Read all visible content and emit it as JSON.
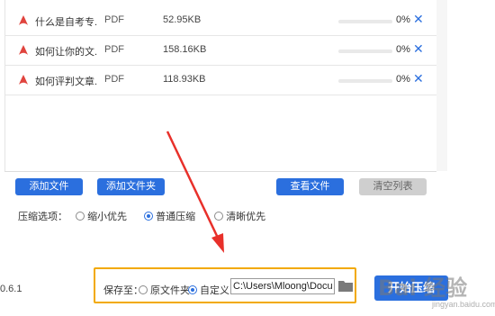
{
  "files": [
    {
      "name": "什么是自考专...",
      "type": "PDF",
      "size": "52.95KB",
      "progress": 0,
      "percent": "0%",
      "delete": "✕"
    },
    {
      "name": "如何让你的文...",
      "type": "PDF",
      "size": "158.16KB",
      "progress": 0,
      "percent": "0%",
      "delete": "✕"
    },
    {
      "name": "如何评判文章...",
      "type": "PDF",
      "size": "118.93KB",
      "progress": 0,
      "percent": "0%",
      "delete": "✕"
    }
  ],
  "toolbar": {
    "add_file": "添加文件",
    "add_folder": "添加文件夹",
    "view_files": "查看文件",
    "clear_list": "清空列表"
  },
  "compression": {
    "label": "压缩选项：",
    "options": [
      "缩小优先",
      "普通压缩",
      "清晰优先"
    ],
    "selected": "普通压缩"
  },
  "version": "0.6.1",
  "save": {
    "label": "保存至：",
    "option_original": "原文件夹",
    "option_custom": "自定义",
    "selected": "自定义",
    "path": "C:\\Users\\Mloong\\Documents"
  },
  "start_button": "开始压缩",
  "watermark": "Bai 经验",
  "watermark_sub": "jingyan.baidu.com",
  "colors": {
    "accent": "#2b6fde",
    "pdf_icon": "#e0443e",
    "highlight_box": "#f2a900",
    "arrow": "#e8302a"
  },
  "icons": {
    "file": "pdf-icon",
    "folder": "folder-icon",
    "delete": "close-icon"
  }
}
